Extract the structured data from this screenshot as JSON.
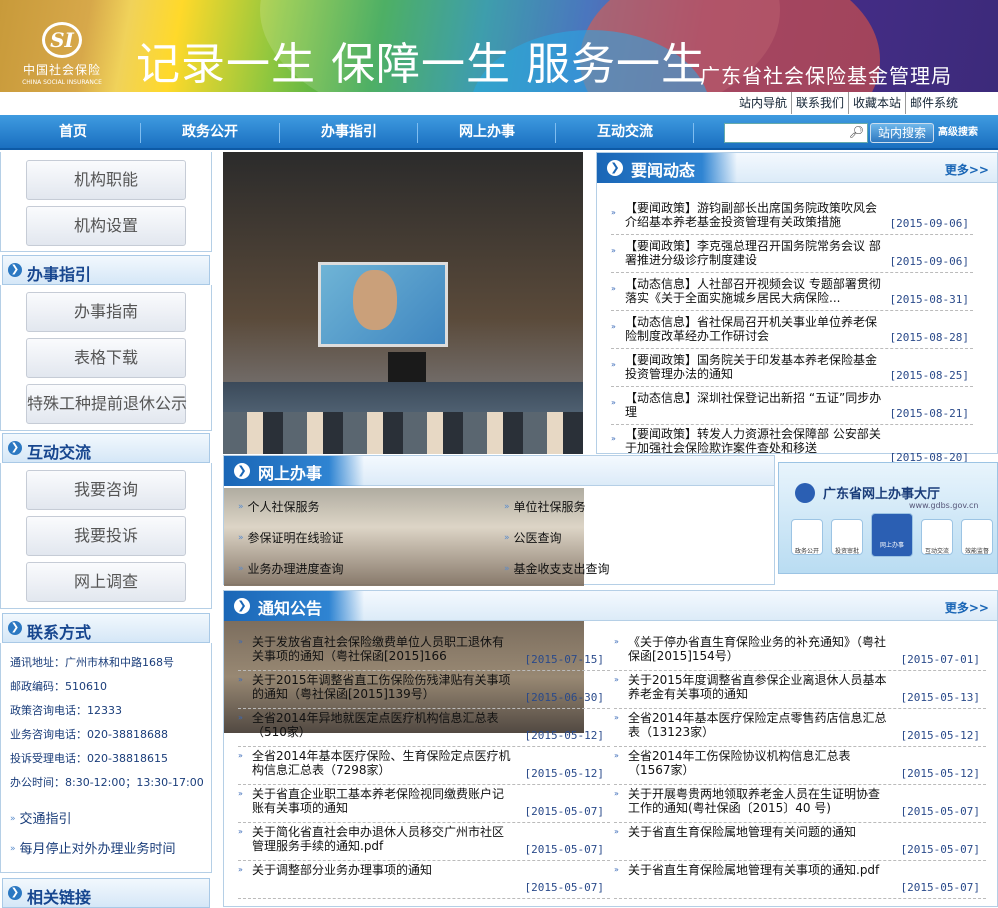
{
  "header": {
    "logo_cn": "中国社会保险",
    "logo_en": "CHINA SOCIAL INSURANCE",
    "slogan": "记录一生  保障一生  服务一生",
    "org_name": "广东省社会保险基金管理局",
    "top_links": [
      "站内导航",
      "联系我们",
      "收藏本站",
      "邮件系统"
    ]
  },
  "nav": {
    "items": [
      "首页",
      "政务公开",
      "办事指引",
      "网上办事",
      "互动交流"
    ],
    "search_placeholder": "",
    "search_button": "站内搜索",
    "advanced_search": "高级搜索"
  },
  "sidebar": {
    "group1": [
      "机构职能",
      "机构设置"
    ],
    "guide_title": "办事指引",
    "guide_items": [
      "办事指南",
      "表格下载",
      "特殊工种提前退休公示"
    ],
    "interact_title": "互动交流",
    "interact_items": [
      "我要咨询",
      "我要投诉",
      "网上调查"
    ],
    "contact_title": "联系方式",
    "contact": [
      "通讯地址：广州市林和中路168号",
      "邮政编码：510610",
      "政策咨询电话：12333",
      "业务咨询电话：020-38818688",
      "投诉受理电话：020-38818615",
      "办公时间：8:30-12:00；13:30-17:00"
    ],
    "links": [
      "交通指引",
      "每月停止对外办理业务时间"
    ],
    "related_title": "相关链接"
  },
  "news": {
    "title": "要闻动态",
    "more": "更多>>",
    "items": [
      {
        "text": "【要闻政策】游钧副部长出席国务院政策吹风会 介绍基本养老基金投资管理有关政策措施",
        "date": "[2015-09-06]"
      },
      {
        "text": "【要闻政策】李克强总理召开国务院常务会议 部署推进分级诊疗制度建设",
        "date": "[2015-09-06]"
      },
      {
        "text": "【动态信息】人社部召开视频会议 专题部署贯彻落实《关于全面实施城乡居民大病保险...",
        "date": "[2015-08-31]"
      },
      {
        "text": "【动态信息】省社保局召开机关事业单位养老保险制度改革经办工作研讨会",
        "date": "[2015-08-28]"
      },
      {
        "text": "【要闻政策】国务院关于印发基本养老保险基金投资管理办法的通知",
        "date": "[2015-08-25]"
      },
      {
        "text": "【动态信息】深圳社保登记出新招 “五证”同步办理",
        "date": "[2015-08-21]"
      },
      {
        "text": "【要闻政策】转发人力资源社会保障部 公安部关于加强社会保险欺诈案件查处和移送",
        "date": "[2015-08-20]"
      }
    ]
  },
  "online": {
    "title": "网上办事",
    "services": [
      "个人社保服务",
      "单位社保服务",
      "参保证明在线验证",
      "公医查询",
      "业务办理进度查询",
      "基金收支支出查询"
    ]
  },
  "hall": {
    "title": "广东省网上办事大厅",
    "subtitle": "www.gdbs.gov.cn",
    "icons": [
      "政务公开",
      "投资审批",
      "网上办事",
      "互动交流",
      "效能监督"
    ]
  },
  "notice": {
    "title": "通知公告",
    "more": "更多>>",
    "items": [
      {
        "text": "关于发放省直社会保险缴费单位人员职工退休有关事项的通知（粤社保函[2015]166",
        "date": "[2015-07-15]"
      },
      {
        "text": "《关于停办省直生育保险业务的补充通知》（粤社保函[2015]154号）",
        "date": "[2015-07-01]"
      },
      {
        "text": "关于2015年调整省直工伤保险伤残津贴有关事项的通知（粤社保函[2015]139号）",
        "date": "[2015-06-30]"
      },
      {
        "text": "关于2015年度调整省直参保企业离退休人员基本养老金有关事项的通知",
        "date": "[2015-05-13]"
      },
      {
        "text": "全省2014年异地就医定点医疗机构信息汇总表（510家）",
        "date": "[2015-05-12]"
      },
      {
        "text": "全省2014年基本医疗保险定点零售药店信息汇总表（13123家）",
        "date": "[2015-05-12]"
      },
      {
        "text": "全省2014年基本医疗保险、生育保险定点医疗机构信息汇总表（7298家）",
        "date": "[2015-05-12]"
      },
      {
        "text": "全省2014年工伤保险协议机构信息汇总表（1567家）",
        "date": "[2015-05-12]"
      },
      {
        "text": "关于省直企业职工基本养老保险视同缴费账户记账有关事项的通知",
        "date": "[2015-05-07]"
      },
      {
        "text": "关于开展粤贵两地领取养老金人员在生证明协查工作的通知(粤社保函〔2015〕40 号)",
        "date": "[2015-05-07]"
      },
      {
        "text": "关于简化省直社会申办退休人员移交广州市社区管理服务手续的通知.pdf",
        "date": "[2015-05-07]"
      },
      {
        "text": "关于省直生育保险属地管理有关问题的通知",
        "date": "[2015-05-07]"
      },
      {
        "text": "关于调整部分业务办理事项的通知",
        "date": "[2015-05-07]"
      },
      {
        "text": "关于省直生育保险属地管理有关事项的通知.pdf",
        "date": "[2015-05-07]"
      }
    ]
  },
  "colors": {
    "nav_blue": "#1a6fc0",
    "title_blue": "#17468f",
    "accent": "#2b78c2"
  }
}
